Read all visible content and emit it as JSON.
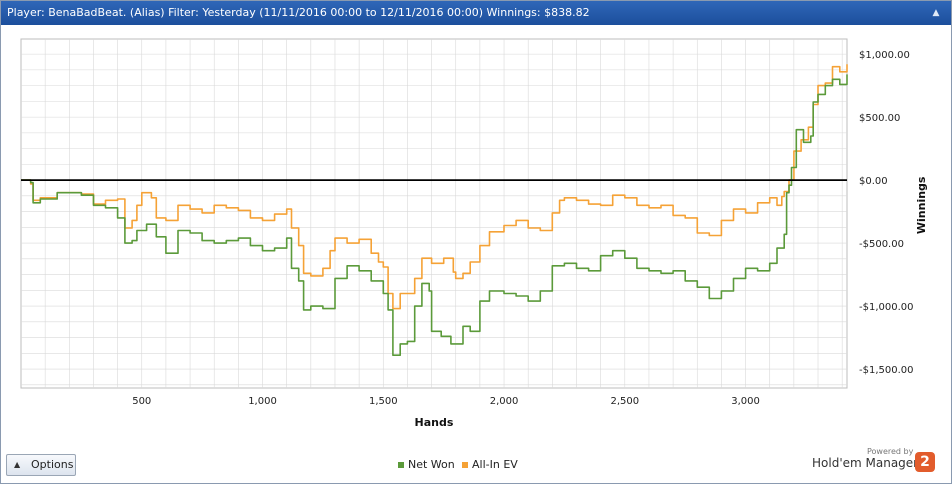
{
  "header": {
    "title": "Player: BenaBadBeat. (Alias) Filter: Yesterday (11/11/2016 00:00 to 12/11/2016 00:00) Winnings: $838.82",
    "collapse_glyph": "▲"
  },
  "options_button": {
    "label": "Options",
    "icon": "triangle-up-icon"
  },
  "branding": {
    "powered_by": "Powered by",
    "name": "Hold'em Manager",
    "badge": "2",
    "badge_color": "#e25c2c"
  },
  "colors": {
    "net_won": "#5b9a3a",
    "all_in_ev": "#f5a236",
    "zero_line": "#000000",
    "grid": "#d9d9d9"
  },
  "chart_data": {
    "type": "line",
    "xlabel": "Hands",
    "ylabel": "Winnings",
    "xlim": [
      0,
      3420
    ],
    "ylim": [
      -1650,
      1120
    ],
    "x_ticks": [
      {
        "value": 500,
        "label": "500"
      },
      {
        "value": 1000,
        "label": "1,000"
      },
      {
        "value": 1500,
        "label": "1,500"
      },
      {
        "value": 2000,
        "label": "2,000"
      },
      {
        "value": 2500,
        "label": "2,500"
      },
      {
        "value": 3000,
        "label": "3,000"
      }
    ],
    "y_ticks": [
      {
        "value": 1000,
        "label": "$1,000.00"
      },
      {
        "value": 500,
        "label": "$500.00"
      },
      {
        "value": 0,
        "label": "$0.00"
      },
      {
        "value": -500,
        "label": "-$500.00"
      },
      {
        "value": -1000,
        "label": "-$1,000.00"
      },
      {
        "value": -1500,
        "label": "-$1,500.00"
      }
    ],
    "grid": true,
    "legend_position": "bottom-center",
    "series": [
      {
        "name": "Net Won",
        "color": "#5b9a3a",
        "points": [
          [
            0,
            0
          ],
          [
            40,
            -20
          ],
          [
            50,
            -180
          ],
          [
            80,
            -150
          ],
          [
            150,
            -100
          ],
          [
            250,
            -120
          ],
          [
            300,
            -200
          ],
          [
            350,
            -220
          ],
          [
            400,
            -300
          ],
          [
            430,
            -500
          ],
          [
            460,
            -480
          ],
          [
            480,
            -400
          ],
          [
            520,
            -350
          ],
          [
            560,
            -450
          ],
          [
            600,
            -580
          ],
          [
            650,
            -400
          ],
          [
            700,
            -420
          ],
          [
            750,
            -480
          ],
          [
            800,
            -500
          ],
          [
            850,
            -480
          ],
          [
            900,
            -460
          ],
          [
            950,
            -520
          ],
          [
            1000,
            -560
          ],
          [
            1050,
            -540
          ],
          [
            1100,
            -460
          ],
          [
            1120,
            -700
          ],
          [
            1150,
            -800
          ],
          [
            1170,
            -1030
          ],
          [
            1200,
            -1000
          ],
          [
            1250,
            -1020
          ],
          [
            1300,
            -780
          ],
          [
            1350,
            -680
          ],
          [
            1400,
            -720
          ],
          [
            1450,
            -800
          ],
          [
            1500,
            -900
          ],
          [
            1520,
            -1030
          ],
          [
            1540,
            -1390
          ],
          [
            1570,
            -1300
          ],
          [
            1600,
            -1280
          ],
          [
            1630,
            -1000
          ],
          [
            1660,
            -820
          ],
          [
            1690,
            -880
          ],
          [
            1700,
            -1200
          ],
          [
            1740,
            -1240
          ],
          [
            1780,
            -1300
          ],
          [
            1830,
            -1160
          ],
          [
            1860,
            -1200
          ],
          [
            1900,
            -960
          ],
          [
            1940,
            -880
          ],
          [
            2000,
            -900
          ],
          [
            2050,
            -920
          ],
          [
            2100,
            -960
          ],
          [
            2150,
            -880
          ],
          [
            2200,
            -680
          ],
          [
            2250,
            -660
          ],
          [
            2300,
            -700
          ],
          [
            2350,
            -720
          ],
          [
            2400,
            -600
          ],
          [
            2450,
            -560
          ],
          [
            2500,
            -620
          ],
          [
            2550,
            -700
          ],
          [
            2600,
            -720
          ],
          [
            2650,
            -740
          ],
          [
            2700,
            -720
          ],
          [
            2750,
            -800
          ],
          [
            2800,
            -850
          ],
          [
            2850,
            -940
          ],
          [
            2900,
            -880
          ],
          [
            2950,
            -780
          ],
          [
            3000,
            -700
          ],
          [
            3050,
            -720
          ],
          [
            3100,
            -660
          ],
          [
            3130,
            -540
          ],
          [
            3160,
            -430
          ],
          [
            3170,
            -100
          ],
          [
            3180,
            -40
          ],
          [
            3190,
            100
          ],
          [
            3210,
            400
          ],
          [
            3240,
            300
          ],
          [
            3270,
            350
          ],
          [
            3280,
            620
          ],
          [
            3300,
            680
          ],
          [
            3330,
            750
          ],
          [
            3360,
            800
          ],
          [
            3390,
            760
          ],
          [
            3420,
            838.82
          ]
        ]
      },
      {
        "name": "All-In EV",
        "color": "#f5a236",
        "points": [
          [
            0,
            0
          ],
          [
            40,
            -30
          ],
          [
            50,
            -160
          ],
          [
            80,
            -140
          ],
          [
            150,
            -100
          ],
          [
            250,
            -110
          ],
          [
            300,
            -190
          ],
          [
            350,
            -160
          ],
          [
            400,
            -150
          ],
          [
            430,
            -380
          ],
          [
            460,
            -320
          ],
          [
            480,
            -200
          ],
          [
            500,
            -100
          ],
          [
            540,
            -140
          ],
          [
            560,
            -300
          ],
          [
            600,
            -320
          ],
          [
            650,
            -200
          ],
          [
            700,
            -230
          ],
          [
            750,
            -260
          ],
          [
            800,
            -200
          ],
          [
            850,
            -220
          ],
          [
            900,
            -240
          ],
          [
            950,
            -300
          ],
          [
            1000,
            -320
          ],
          [
            1050,
            -270
          ],
          [
            1100,
            -230
          ],
          [
            1120,
            -380
          ],
          [
            1150,
            -520
          ],
          [
            1170,
            -740
          ],
          [
            1200,
            -760
          ],
          [
            1250,
            -700
          ],
          [
            1280,
            -560
          ],
          [
            1300,
            -460
          ],
          [
            1350,
            -500
          ],
          [
            1400,
            -470
          ],
          [
            1450,
            -580
          ],
          [
            1480,
            -650
          ],
          [
            1500,
            -690
          ],
          [
            1520,
            -900
          ],
          [
            1540,
            -1020
          ],
          [
            1570,
            -900
          ],
          [
            1600,
            -900
          ],
          [
            1630,
            -780
          ],
          [
            1660,
            -620
          ],
          [
            1700,
            -660
          ],
          [
            1750,
            -620
          ],
          [
            1790,
            -730
          ],
          [
            1800,
            -780
          ],
          [
            1830,
            -740
          ],
          [
            1860,
            -650
          ],
          [
            1900,
            -520
          ],
          [
            1940,
            -410
          ],
          [
            2000,
            -360
          ],
          [
            2050,
            -320
          ],
          [
            2100,
            -380
          ],
          [
            2150,
            -400
          ],
          [
            2200,
            -260
          ],
          [
            2230,
            -160
          ],
          [
            2250,
            -140
          ],
          [
            2300,
            -160
          ],
          [
            2350,
            -190
          ],
          [
            2400,
            -200
          ],
          [
            2450,
            -120
          ],
          [
            2500,
            -140
          ],
          [
            2550,
            -200
          ],
          [
            2600,
            -220
          ],
          [
            2650,
            -200
          ],
          [
            2700,
            -280
          ],
          [
            2750,
            -300
          ],
          [
            2800,
            -420
          ],
          [
            2850,
            -440
          ],
          [
            2900,
            -320
          ],
          [
            2950,
            -230
          ],
          [
            3000,
            -260
          ],
          [
            3050,
            -180
          ],
          [
            3100,
            -140
          ],
          [
            3130,
            -200
          ],
          [
            3150,
            -130
          ],
          [
            3160,
            -90
          ],
          [
            3180,
            0
          ],
          [
            3200,
            230
          ],
          [
            3230,
            320
          ],
          [
            3260,
            420
          ],
          [
            3280,
            600
          ],
          [
            3300,
            750
          ],
          [
            3330,
            770
          ],
          [
            3360,
            900
          ],
          [
            3390,
            860
          ],
          [
            3420,
            920
          ]
        ]
      }
    ]
  }
}
